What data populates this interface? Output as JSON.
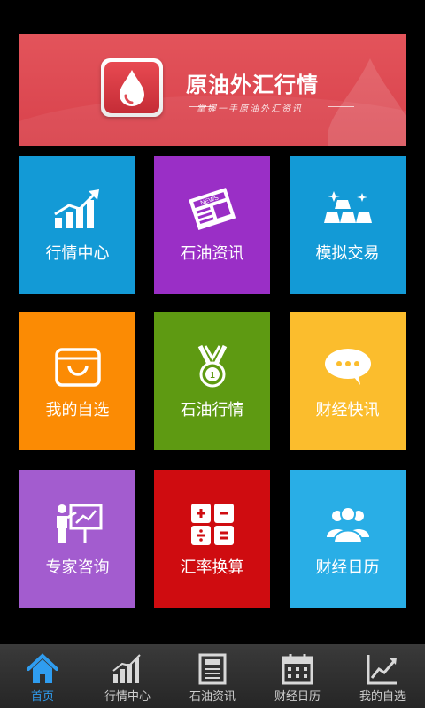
{
  "banner": {
    "title": "原油外汇行情",
    "subtitle": "掌握一手原油外汇资讯"
  },
  "tiles": [
    {
      "label": "行情中心",
      "color": "#139ad6",
      "icon": "chart-up-icon"
    },
    {
      "label": "石油资讯",
      "color": "#9a2fc6",
      "icon": "newspaper-icon"
    },
    {
      "label": "模拟交易",
      "color": "#139ad6",
      "icon": "gold-bars-icon"
    },
    {
      "label": "我的自选",
      "color": "#fb8b04",
      "icon": "shopping-bag-icon"
    },
    {
      "label": "石油行情",
      "color": "#5e9a12",
      "icon": "medal-icon"
    },
    {
      "label": "财经快讯",
      "color": "#fbbd2d",
      "icon": "chat-bubbles-icon"
    },
    {
      "label": "专家咨询",
      "color": "#a35ccf",
      "icon": "presenter-icon"
    },
    {
      "label": "汇率换算",
      "color": "#cf0c10",
      "icon": "calculator-icon"
    },
    {
      "label": "财经日历",
      "color": "#29aee6",
      "icon": "people-icon"
    }
  ],
  "tabbar": {
    "accent": "#2f9df0",
    "items": [
      {
        "label": "首页",
        "icon": "home-icon",
        "active": true
      },
      {
        "label": "行情中心",
        "icon": "bar-chart-icon",
        "active": false
      },
      {
        "label": "石油资讯",
        "icon": "newspaper-icon",
        "active": false
      },
      {
        "label": "财经日历",
        "icon": "calendar-icon",
        "active": false
      },
      {
        "label": "我的自选",
        "icon": "line-chart-icon",
        "active": false
      }
    ]
  }
}
